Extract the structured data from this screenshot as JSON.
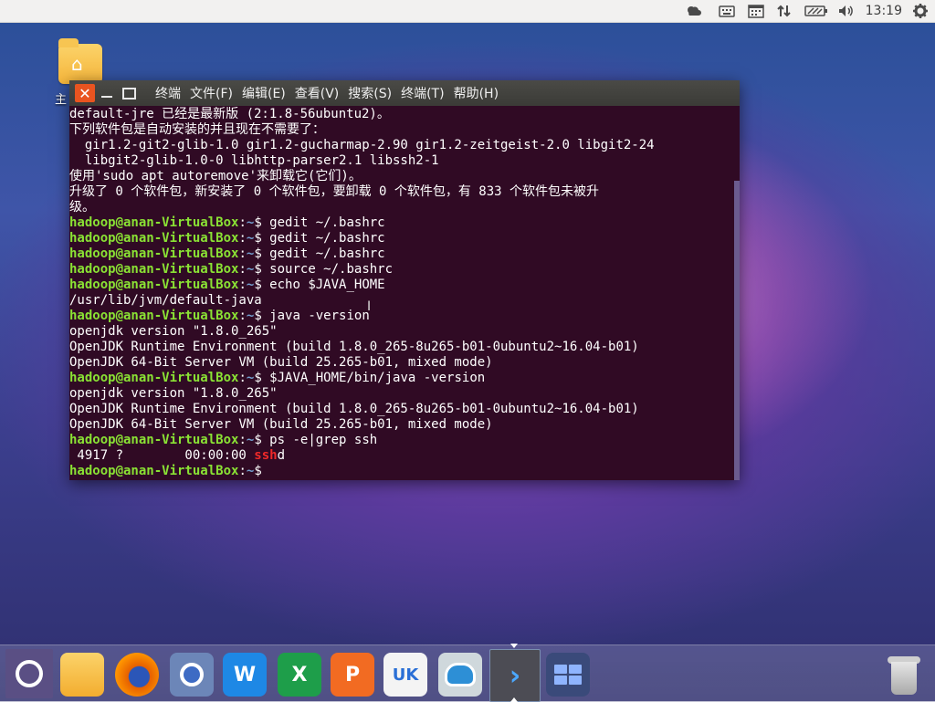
{
  "panel": {
    "clock": "13:19",
    "icons": [
      "weather-icon",
      "keyboard-icon",
      "calendar-icon",
      "network-transfer-icon",
      "battery-icon",
      "volume-icon",
      "settings-gear-icon"
    ]
  },
  "desktop": {
    "home_folder_label": "主"
  },
  "terminal": {
    "menu": {
      "title": "终端",
      "file": "文件(F)",
      "edit": "编辑(E)",
      "view": "查看(V)",
      "search": "搜索(S)",
      "terminal": "终端(T)",
      "help": "帮助(H)"
    },
    "prompt_user": "hadoop@anan-VirtualBox",
    "prompt_sep": ":",
    "prompt_path": "~",
    "prompt_sign": "$",
    "lines": [
      {
        "type": "out",
        "text": "default-jre 已经是最新版 (2:1.8-56ubuntu2)。"
      },
      {
        "type": "out",
        "text": "下列软件包是自动安装的并且现在不需要了："
      },
      {
        "type": "out",
        "text": "  gir1.2-git2-glib-1.0 gir1.2-gucharmap-2.90 gir1.2-zeitgeist-2.0 libgit2-24"
      },
      {
        "type": "out",
        "text": "  libgit2-glib-1.0-0 libhttp-parser2.1 libssh2-1"
      },
      {
        "type": "out",
        "text": "使用'sudo apt autoremove'来卸载它(它们)。"
      },
      {
        "type": "out",
        "text": "升级了 0 个软件包，新安装了 0 个软件包，要卸载 0 个软件包，有 833 个软件包未被升"
      },
      {
        "type": "out",
        "text": "级。"
      },
      {
        "type": "cmd",
        "text": " gedit ~/.bashrc"
      },
      {
        "type": "cmd",
        "text": " gedit ~/.bashrc"
      },
      {
        "type": "cmd",
        "text": " gedit ~/.bashrc"
      },
      {
        "type": "cmd",
        "text": " source ~/.bashrc"
      },
      {
        "type": "cmd",
        "text": " echo $JAVA_HOME"
      },
      {
        "type": "out",
        "text": "/usr/lib/jvm/default-java"
      },
      {
        "type": "cmd",
        "text": " java -version"
      },
      {
        "type": "out",
        "text": "openjdk version \"1.8.0_265\""
      },
      {
        "type": "out",
        "text": "OpenJDK Runtime Environment (build 1.8.0_265-8u265-b01-0ubuntu2~16.04-b01)"
      },
      {
        "type": "out",
        "text": "OpenJDK 64-Bit Server VM (build 25.265-b01, mixed mode)"
      },
      {
        "type": "cmd",
        "text": " $JAVA_HOME/bin/java -version"
      },
      {
        "type": "out",
        "text": "openjdk version \"1.8.0_265\""
      },
      {
        "type": "out",
        "text": "OpenJDK Runtime Environment (build 1.8.0_265-8u265-b01-0ubuntu2~16.04-b01)"
      },
      {
        "type": "out",
        "text": "OpenJDK 64-Bit Server VM (build 25.265-b01, mixed mode)"
      },
      {
        "type": "cmd",
        "text": " ps -e|grep ssh"
      },
      {
        "type": "grep",
        "text": " 4917 ?        00:00:00 ",
        "match": "ssh",
        "rest": "d"
      },
      {
        "type": "cmd",
        "text": ""
      }
    ]
  },
  "dock": {
    "items": [
      {
        "name": "dock-ubuntu-launcher",
        "label": ""
      },
      {
        "name": "dock-files",
        "label": ""
      },
      {
        "name": "dock-firefox",
        "label": ""
      },
      {
        "name": "dock-chromium",
        "label": ""
      },
      {
        "name": "dock-wps-writer",
        "label": "W"
      },
      {
        "name": "dock-wps-spreadsheets",
        "label": "X"
      },
      {
        "name": "dock-wps-presentation",
        "label": "P"
      },
      {
        "name": "dock-ubuntu-kylin-store",
        "label": "UK"
      },
      {
        "name": "dock-assistant",
        "label": ""
      },
      {
        "name": "dock-terminal",
        "label": ""
      },
      {
        "name": "dock-workspaces",
        "label": ""
      },
      {
        "name": "dock-trash",
        "label": ""
      }
    ],
    "word_label": "W",
    "excel_label": "X",
    "ppt_label": "P",
    "store_label": "UK",
    "terminal_glyph": "›"
  },
  "colors": {
    "terminal_bg": "#300a24",
    "prompt_user": "#8ae234",
    "prompt_path": "#729fcf",
    "grep_match": "#ef2929",
    "close_button": "#e95420"
  }
}
